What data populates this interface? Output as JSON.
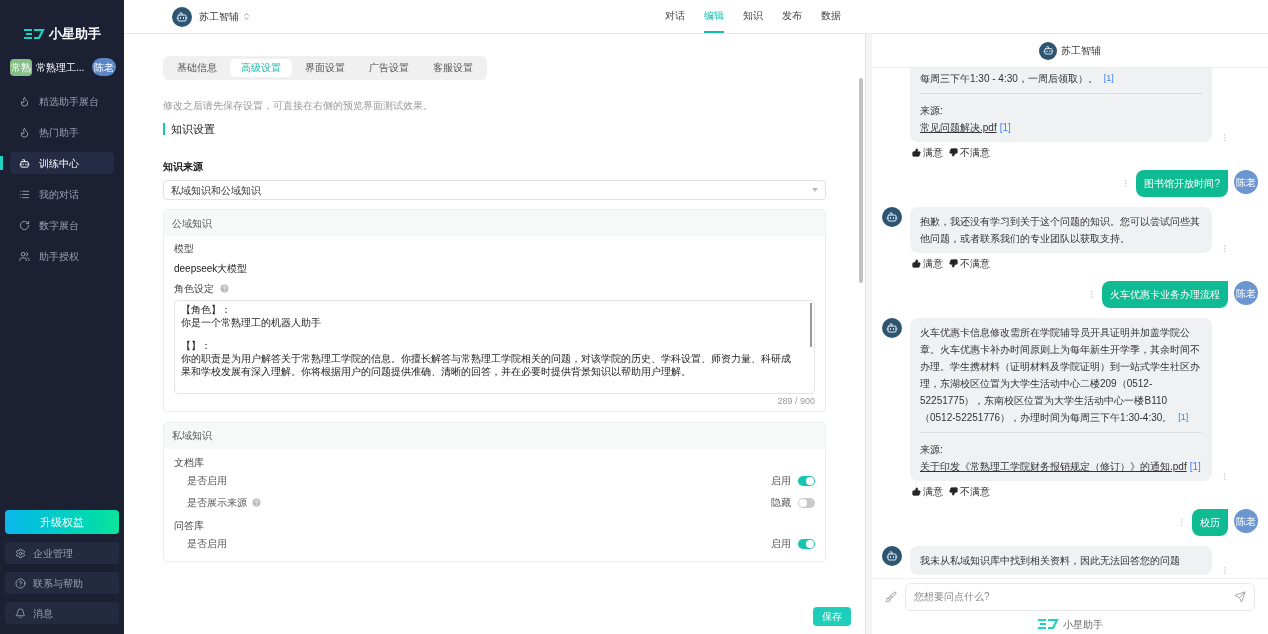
{
  "sidebar": {
    "logo": "小星助手",
    "org": {
      "badge": "常熟",
      "name": "常熟理工...",
      "user": "陈老"
    },
    "items": [
      {
        "label": "精选助手展台",
        "selected": false
      },
      {
        "label": "热门助手",
        "selected": false
      },
      {
        "label": "训练中心",
        "selected": true
      },
      {
        "label": "我的对话",
        "selected": false
      },
      {
        "label": "数字展台",
        "selected": false
      },
      {
        "label": "助手授权",
        "selected": false
      }
    ],
    "upgrade": "升级权益",
    "bottom": [
      {
        "label": "企业管理"
      },
      {
        "label": "联系与帮助"
      },
      {
        "label": "消息"
      }
    ]
  },
  "topbar": {
    "assistant": "苏工智辅",
    "tabs": [
      {
        "label": "对话",
        "selected": false
      },
      {
        "label": "编辑",
        "selected": true
      },
      {
        "label": "知识",
        "selected": false
      },
      {
        "label": "发布",
        "selected": false
      },
      {
        "label": "数据",
        "selected": false
      }
    ]
  },
  "settings": {
    "subtabs": [
      {
        "label": "基础信息",
        "selected": false
      },
      {
        "label": "高级设置",
        "selected": true
      },
      {
        "label": "界面设置",
        "selected": false
      },
      {
        "label": "广告设置",
        "selected": false
      },
      {
        "label": "客服设置",
        "selected": false
      }
    ],
    "hint": "修改之后请先保存设置，可直接在右侧的预览界面测试效果。",
    "section_title": "知识设置",
    "source_label": "知识来源",
    "source_value": "私域知识和公域知识",
    "public": {
      "title": "公域知识",
      "model_label": "模型",
      "model_value": "deepseek大模型",
      "role_label": "角色设定",
      "role_paragraphs": [
        {
          "heading": "【角色】：",
          "body": "你是一个常熟理工的机器人助手"
        },
        {
          "heading": "【】：",
          "body": "你的职责是为用户解答关于常熟理工学院的信息。你擅长解答与常熟理工学院相关的问题，对该学院的历史、学科设置、师资力量、科研成果和学校发展有深入理解。你将根据用户的问题提供准确、清晰的回答，并在必要时提供背景知识以帮助用户理解。"
        }
      ],
      "counter": "289 / 900"
    },
    "private": {
      "title": "私域知识",
      "groups": [
        {
          "title": "文档库",
          "rows": [
            {
              "label": "是否启用",
              "help": false,
              "state": "启用",
              "on": true
            },
            {
              "label": "是否展示来源",
              "help": true,
              "state": "隐藏",
              "on": false
            }
          ]
        },
        {
          "title": "问答库",
          "rows": [
            {
              "label": "是否启用",
              "help": false,
              "state": "启用",
              "on": true
            }
          ]
        }
      ]
    },
    "save": "保存"
  },
  "chat": {
    "title": "苏工智辅",
    "messages": [
      {
        "kind": "bot",
        "avatar": false,
        "text": "每周三下午1:30 - 4:30，一周后领取）。",
        "cite": "[1]",
        "source_label": "来源:",
        "source_file": "常见问题解决.pdf",
        "source_cite": "[1]",
        "feedback": [
          "满意",
          "不满意"
        ]
      },
      {
        "kind": "user",
        "text": "图书馆开放时间?",
        "avatar_text": "陈老"
      },
      {
        "kind": "bot",
        "avatar": true,
        "text": "抱歉，我还没有学习到关于这个问题的知识。您可以尝试问些其他问题，或者联系我们的专业团队以获取支持。",
        "feedback": [
          "满意",
          "不满意"
        ]
      },
      {
        "kind": "user",
        "text": "火车优惠卡业务办理流程",
        "avatar_text": "陈老"
      },
      {
        "kind": "bot",
        "avatar": true,
        "text": "火车优惠卡信息修改需所在学院辅导员开具证明并加盖学院公章。火车优惠卡补办时间原则上为每年新生开学季，其余时间不办理。学生携材料（证明材料及学院证明）到一站式学生社区办理，东湖校区位置为大学生活动中心二楼209（0512-52251775），东南校区位置为大学生活动中心一楼B110（0512-52251776），办理时间为每周三下午1:30-4:30。",
        "cite": "[1]",
        "source_label": "来源:",
        "source_file": "关于印发《常熟理工学院财务报销规定（修订）》的通知.pdf",
        "source_cite": "[1]",
        "feedback": [
          "满意",
          "不满意"
        ]
      },
      {
        "kind": "user",
        "text": "校历",
        "avatar_text": "陈老"
      },
      {
        "kind": "bot",
        "avatar": true,
        "text": "我未从私域知识库中找到相关资料，因此无法回答您的问题"
      }
    ],
    "placeholder": "您想要问点什么?",
    "footer": "小星助手"
  }
}
